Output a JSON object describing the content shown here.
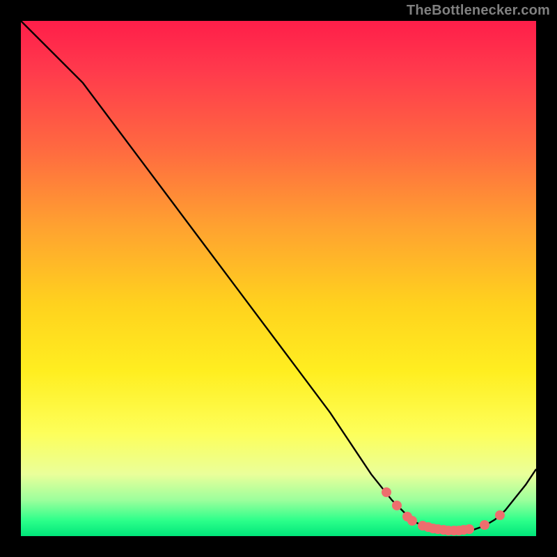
{
  "attribution": "TheBottlenecker.com",
  "chart_data": {
    "type": "line",
    "title": "",
    "xlabel": "",
    "ylabel": "",
    "xlim": [
      0,
      100
    ],
    "ylim": [
      0,
      100
    ],
    "series": [
      {
        "name": "curve",
        "x": [
          0,
          6,
          12,
          18,
          24,
          30,
          36,
          42,
          48,
          54,
          60,
          64,
          68,
          72,
          74,
          76,
          78,
          80,
          82,
          84,
          86,
          88,
          90,
          92,
          94,
          96,
          98,
          100
        ],
        "y": [
          100,
          94,
          88,
          80,
          72,
          64,
          56,
          48,
          40,
          32,
          24,
          18,
          12,
          7,
          5,
          3,
          2,
          1.5,
          1.2,
          1.0,
          1.0,
          1.3,
          2.0,
          3.2,
          5.0,
          7.5,
          10,
          13
        ]
      },
      {
        "name": "highlight-dots",
        "x": [
          71,
          73,
          75,
          76,
          78,
          79,
          80,
          81,
          82,
          83,
          84,
          85,
          86,
          87,
          90,
          93
        ],
        "y": [
          8.5,
          6.0,
          3.8,
          3.0,
          2.0,
          1.7,
          1.5,
          1.3,
          1.2,
          1.1,
          1.1,
          1.1,
          1.2,
          1.4,
          2.2,
          4.0
        ]
      }
    ],
    "gradient_stops": [
      {
        "pos": 0,
        "color": "#ff1e4a"
      },
      {
        "pos": 55,
        "color": "#ffd21e"
      },
      {
        "pos": 88,
        "color": "#eaff9a"
      },
      {
        "pos": 100,
        "color": "#00e67a"
      }
    ]
  }
}
